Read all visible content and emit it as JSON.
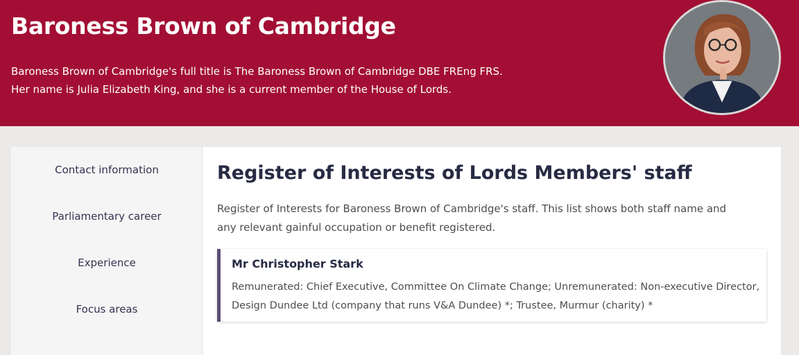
{
  "header": {
    "title": "Baroness Brown of Cambridge",
    "description": "Baroness Brown of Cambridge's full title is The Baroness Brown of Cambridge DBE FREng FRS. Her name is Julia Elizabeth King, and she is a current member of the House of Lords."
  },
  "sidebar": {
    "items": [
      {
        "label": "Contact information"
      },
      {
        "label": "Parliamentary career"
      },
      {
        "label": "Experience"
      },
      {
        "label": "Focus areas"
      }
    ]
  },
  "main": {
    "heading": "Register of Interests of Lords Members' staff",
    "intro": "Register of Interests for Baroness Brown of Cambridge's staff. This list shows both staff name and any relevant gainful occupation or benefit registered.",
    "staff": [
      {
        "name": "Mr Christopher Stark",
        "interests": "Remunerated: Chief Executive, Committee On Climate Change; Unremunerated: Non-executive Director, Design Dundee Ltd (company that runs V&A Dundee) *; Trustee, Murmur (charity) *"
      }
    ]
  },
  "colors": {
    "banner": "#a30f34",
    "accent_border": "#5a4f72",
    "page_background": "#eceae8"
  }
}
